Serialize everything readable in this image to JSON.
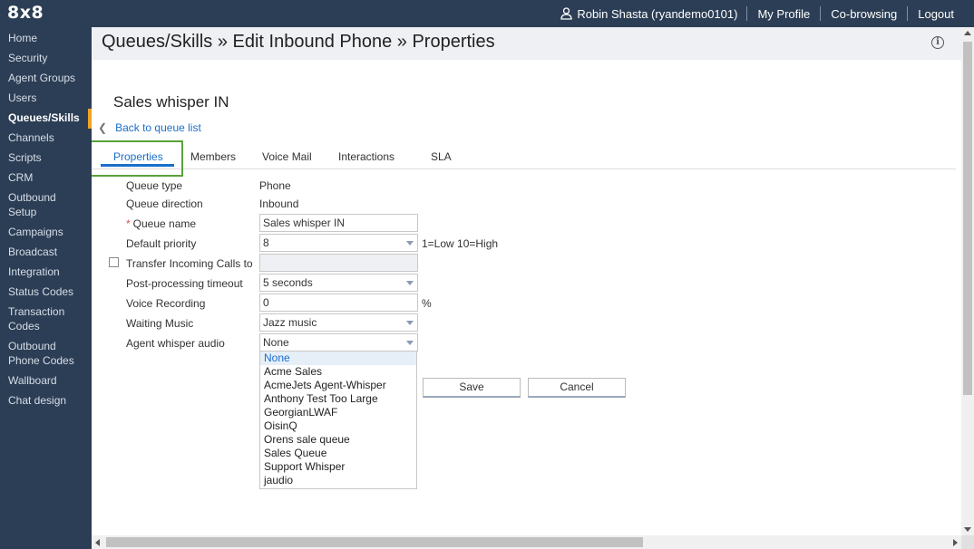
{
  "app": {
    "logo": "8x8"
  },
  "topnav": {
    "user": "Robin Shasta (ryandemo0101)",
    "my_profile": "My Profile",
    "co_browsing": "Co-browsing",
    "logout": "Logout"
  },
  "sidebar": {
    "items": [
      {
        "label": "Home"
      },
      {
        "label": "Security"
      },
      {
        "label": "Agent Groups"
      },
      {
        "label": "Users"
      },
      {
        "label": "Queues/Skills"
      },
      {
        "label": "Channels"
      },
      {
        "label": "Scripts"
      },
      {
        "label": "CRM"
      },
      {
        "label": "Outbound Setup"
      },
      {
        "label": "Campaigns"
      },
      {
        "label": "Broadcast"
      },
      {
        "label": "Integration"
      },
      {
        "label": "Status Codes"
      },
      {
        "label": "Transaction Codes"
      },
      {
        "label": "Outbound Phone Codes"
      },
      {
        "label": "Wallboard"
      },
      {
        "label": "Chat design"
      }
    ],
    "active": "Queues/Skills",
    "accent_color": "#f0a229"
  },
  "page": {
    "title": "Queues/Skills » Edit Inbound Phone » Properties",
    "queue_name_heading": "Sales whisper IN",
    "back_link": "Back to queue list"
  },
  "tabs": [
    {
      "label": "Properties"
    },
    {
      "label": "Members"
    },
    {
      "label": "Voice Mail"
    },
    {
      "label": "Interactions"
    },
    {
      "label": "SLA"
    }
  ],
  "form": {
    "queue_type": {
      "label": "Queue type",
      "value": "Phone"
    },
    "queue_direction": {
      "label": "Queue direction",
      "value": "Inbound"
    },
    "queue_name": {
      "required_mark": "*",
      "label": "Queue name",
      "value": "Sales whisper IN"
    },
    "default_priority": {
      "label": "Default priority",
      "value": "8",
      "hint": "1=Low 10=High"
    },
    "transfer_incoming": {
      "label": "Transfer Incoming Calls to",
      "checked": false,
      "value": ""
    },
    "post_processing": {
      "label": "Post-processing timeout",
      "value": "5 seconds"
    },
    "voice_recording": {
      "label": "Voice Recording",
      "value": "0",
      "unit": "%"
    },
    "waiting_music": {
      "label": "Waiting Music",
      "value": "Jazz music"
    },
    "agent_whisper": {
      "label": "Agent whisper audio",
      "value": "None",
      "options": [
        "None",
        "Acme Sales",
        "AcmeJets Agent-Whisper",
        "Anthony Test Too Large",
        "GeorgianLWAF",
        "OisinQ",
        "Orens sale queue",
        "Sales Queue",
        "Support Whisper",
        "jaudio"
      ]
    }
  },
  "buttons": {
    "save": "Save",
    "cancel": "Cancel"
  },
  "colors": {
    "nav_bg": "#2c3e55",
    "link": "#1a6fc9",
    "tab_highlight": "#58a23a"
  }
}
